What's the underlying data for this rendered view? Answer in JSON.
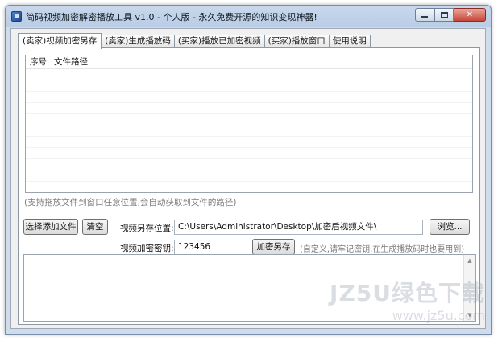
{
  "window": {
    "title": "简码视频加密解密播放工具 v1.0 - 个人版 - 永久免费开源的知识变现神器!",
    "controls": {
      "min_icon": "minimize-icon",
      "max_icon": "maximize-icon",
      "close_icon": "close-icon",
      "close_glyph": "✕"
    }
  },
  "tabs": [
    {
      "label": "(卖家)视频加密另存",
      "active": true
    },
    {
      "label": "(卖家)生成播放码"
    },
    {
      "label": "(买家)播放已加密视频"
    },
    {
      "label": "(买家)播放窗口"
    },
    {
      "label": "使用说明"
    }
  ],
  "file_list": {
    "columns": [
      "序号",
      "文件路径"
    ],
    "rows": [],
    "hint": "(支持拖放文件到窗口任意位置,会自动获取到文件的路径)"
  },
  "actions": {
    "add_files_label": "选择添加文件",
    "clear_label": "清空",
    "save_path_label": "视频另存位置:",
    "save_path_value": "C:\\Users\\Administrator\\Desktop\\加密后视频文件\\",
    "browse_label": "浏览...",
    "key_label": "视频加密密钥:",
    "key_value": "123456",
    "encrypt_save_label": "加密另存",
    "key_note": "(自定义,请牢记密钥,在生成播放码时也要用到)"
  },
  "log": {
    "text": ""
  },
  "watermark": {
    "brand": "JZ5U绿色下载",
    "url": "www.jz5u.com"
  },
  "colors": {
    "title_bar": "#c9d8ec",
    "client_bg": "#f0f0f0",
    "close_button": "#c7463a"
  }
}
